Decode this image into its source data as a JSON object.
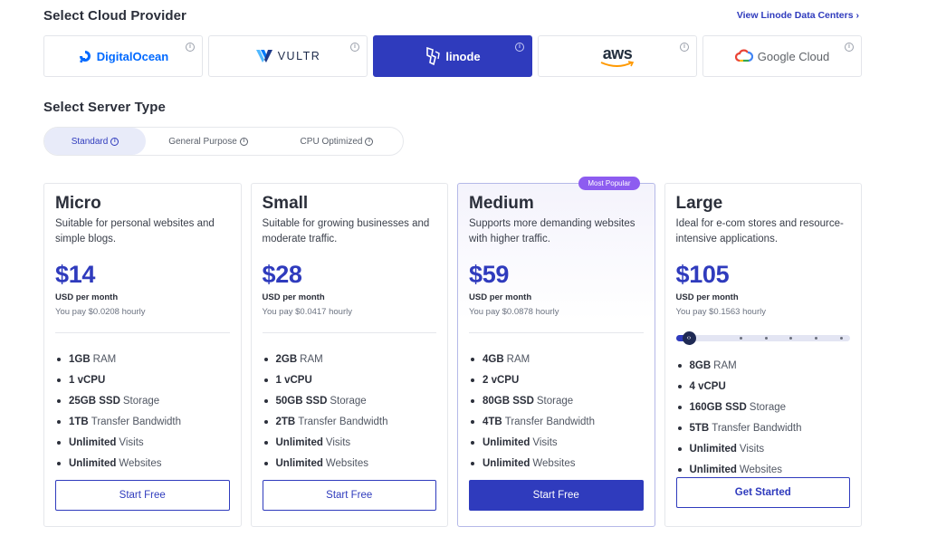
{
  "providers_section": {
    "title": "Select Cloud Provider",
    "link": "View Linode Data Centers ›",
    "providers": [
      {
        "name": "DigitalOcean",
        "icon": "digitalocean-logo-icon",
        "active": false
      },
      {
        "name": "VULTR",
        "icon": "vultr-logo-icon",
        "active": false
      },
      {
        "name": "linode",
        "icon": "linode-logo-icon",
        "active": true
      },
      {
        "name": "aws",
        "icon": "aws-logo-icon",
        "active": false
      },
      {
        "name": "Google Cloud",
        "icon": "google-cloud-logo-icon",
        "active": false
      }
    ],
    "info_glyph": "i"
  },
  "server_type": {
    "title": "Select Server Type",
    "tabs": [
      {
        "label": "Standard",
        "active": true
      },
      {
        "label": "General Purpose",
        "active": false
      },
      {
        "label": "CPU Optimized",
        "active": false
      }
    ]
  },
  "plans": [
    {
      "name": "Micro",
      "description": "Suitable for personal websites and simple blogs.",
      "price": "$14",
      "per": "USD per month",
      "hourly": "You pay $0.0208 hourly",
      "features": [
        {
          "value": "1GB",
          "label": "RAM"
        },
        {
          "value": "1 vCPU",
          "label": ""
        },
        {
          "value": "25GB SSD",
          "label": "Storage"
        },
        {
          "value": "1TB",
          "label": "Transfer Bandwidth"
        },
        {
          "value": "Unlimited",
          "label": "Visits"
        },
        {
          "value": "Unlimited",
          "label": "Websites"
        }
      ],
      "cta": "Start Free"
    },
    {
      "name": "Small",
      "description": "Suitable for growing businesses and moderate traffic.",
      "price": "$28",
      "per": "USD per month",
      "hourly": "You pay $0.0417 hourly",
      "features": [
        {
          "value": "2GB",
          "label": "RAM"
        },
        {
          "value": "1 vCPU",
          "label": ""
        },
        {
          "value": "50GB SSD",
          "label": "Storage"
        },
        {
          "value": "2TB",
          "label": "Transfer Bandwidth"
        },
        {
          "value": "Unlimited",
          "label": "Visits"
        },
        {
          "value": "Unlimited",
          "label": "Websites"
        }
      ],
      "cta": "Start Free"
    },
    {
      "name": "Medium",
      "badge": "Most Popular",
      "description": "Supports more demanding websites with higher traffic.",
      "price": "$59",
      "per": "USD per month",
      "hourly": "You pay $0.0878 hourly",
      "features": [
        {
          "value": "4GB",
          "label": "RAM"
        },
        {
          "value": "2 vCPU",
          "label": ""
        },
        {
          "value": "80GB SSD",
          "label": "Storage"
        },
        {
          "value": "4TB",
          "label": "Transfer Bandwidth"
        },
        {
          "value": "Unlimited",
          "label": "Visits"
        },
        {
          "value": "Unlimited",
          "label": "Websites"
        }
      ],
      "cta": "Start Free"
    },
    {
      "name": "Large",
      "description": "Ideal for e-com stores and resource-intensive applications.",
      "price": "$105",
      "per": "USD per month",
      "hourly": "You pay $0.1563 hourly",
      "slider": {
        "steps": 7,
        "selected": 1,
        "knob_glyph": "‹›"
      },
      "features": [
        {
          "value": "8GB",
          "label": "RAM"
        },
        {
          "value": "4 vCPU",
          "label": ""
        },
        {
          "value": "160GB SSD",
          "label": "Storage"
        },
        {
          "value": "5TB",
          "label": "Transfer Bandwidth"
        },
        {
          "value": "Unlimited",
          "label": "Visits"
        },
        {
          "value": "Unlimited",
          "label": "Websites"
        }
      ],
      "cta": "Get Started"
    }
  ],
  "colors": {
    "primary": "#2f3bbd",
    "badge": "#8d5cf0",
    "digitalocean": "#0069ff",
    "aws_smile": "#ff9900"
  }
}
